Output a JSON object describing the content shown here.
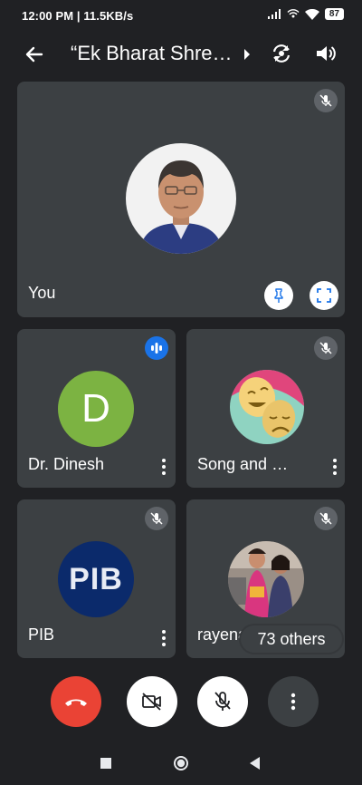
{
  "status": {
    "time_speed": "12:00 PM | 11.5KB/s",
    "battery": "87"
  },
  "header": {
    "title": "“Ek Bharat Shre…"
  },
  "tiles": {
    "self": {
      "name": "You"
    },
    "p1": {
      "name": "Dr. Dinesh",
      "initial": "D"
    },
    "p2": {
      "name": "Song and …"
    },
    "p3": {
      "name": "PIB",
      "logo_text": "PIB"
    },
    "p4": {
      "name": "rayena sarkar"
    }
  },
  "others_chip": "73 others",
  "colors": {
    "background": "#202124",
    "tile": "#3c4043",
    "accent_blue": "#1a73e8",
    "end_call_red": "#ea4335",
    "avatar_green": "#7cb342",
    "pib_navy": "#0b2a6b"
  },
  "icons": {
    "back": "arrow-left-icon",
    "switch_camera": "switch-camera-icon",
    "speaker": "speaker-icon",
    "mic_off": "mic-off-icon",
    "pin": "pin-icon",
    "fullscreen": "fullscreen-icon",
    "more": "more-vert-icon",
    "end_call": "end-call-icon",
    "camera_off": "camera-off-icon"
  }
}
